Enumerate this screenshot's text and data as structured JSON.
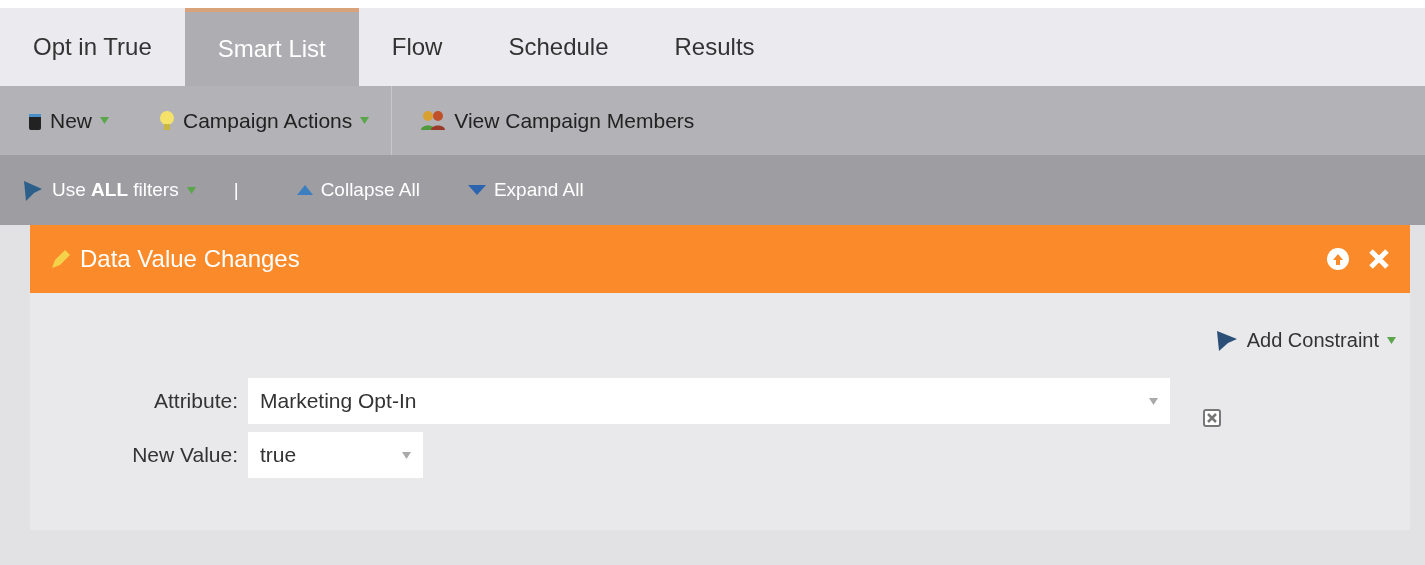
{
  "tabs": [
    {
      "label": "Opt in True",
      "selected": false
    },
    {
      "label": "Smart List",
      "selected": true
    },
    {
      "label": "Flow",
      "selected": false
    },
    {
      "label": "Schedule",
      "selected": false
    },
    {
      "label": "Results",
      "selected": false
    }
  ],
  "toolbar": [
    {
      "label": "New",
      "kind": "new"
    },
    {
      "label": "Campaign Actions",
      "kind": "actions"
    },
    {
      "label": "View Campaign Members",
      "kind": "members"
    }
  ],
  "filter_bar": {
    "logic": "Use **ALL** filters",
    "separator": "|",
    "collapse": "Collapse All",
    "expand": "Expand All"
  },
  "filter": {
    "title": "Data Value Changes",
    "add_constraint": "Add Constraint",
    "fields": [
      {
        "label": "Attribute:",
        "value": "Marketing Opt-In",
        "kind": "wide"
      },
      {
        "label": "New Value:",
        "value": "true",
        "kind": "narrow"
      }
    ]
  }
}
